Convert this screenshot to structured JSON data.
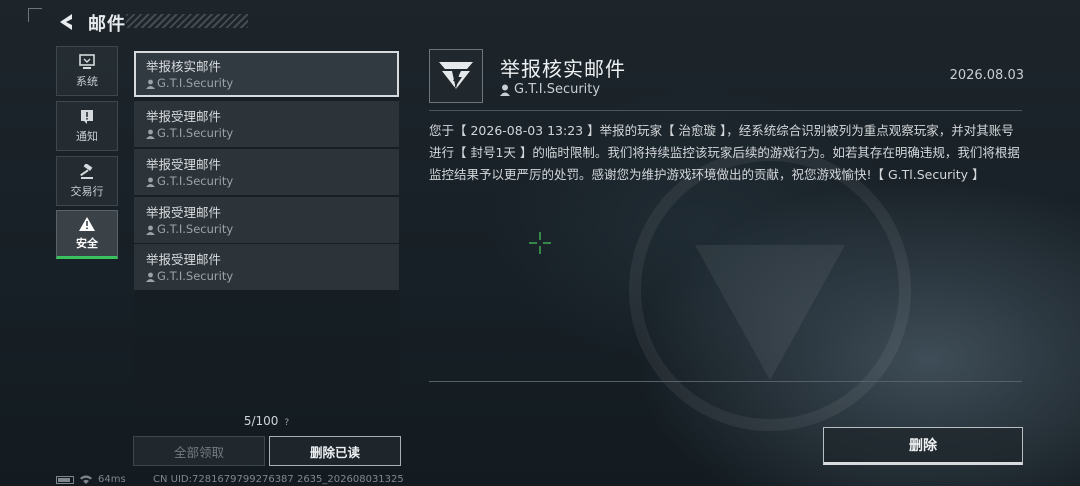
{
  "header": {
    "title": "邮件",
    "back_icon": "back-arrow-icon"
  },
  "categories": [
    {
      "label": "系统",
      "icon": "monitor-icon",
      "active": false
    },
    {
      "label": "通知",
      "icon": "alert-note-icon",
      "active": false
    },
    {
      "label": "交易行",
      "icon": "gavel-icon",
      "active": false
    },
    {
      "label": "安全",
      "icon": "warning-icon",
      "active": true
    }
  ],
  "mails": [
    {
      "subject": "举报核实邮件",
      "sender": "G.T.I.Security",
      "selected": true
    },
    {
      "subject": "举报受理邮件",
      "sender": "G.T.I.Security",
      "selected": false
    },
    {
      "subject": "举报受理邮件",
      "sender": "G.T.I.Security",
      "selected": false
    },
    {
      "subject": "举报受理邮件",
      "sender": "G.T.I.Security",
      "selected": false
    },
    {
      "subject": "举报受理邮件",
      "sender": "G.T.I.Security",
      "selected": false
    }
  ],
  "mail_count": "5/100",
  "help_mark": "?",
  "buttons": {
    "claim_all": "全部领取",
    "delete_read": "删除已读",
    "delete": "删除"
  },
  "detail": {
    "title": "举报核实邮件",
    "sender": "G.T.I.Security",
    "date": "2026.08.03",
    "body": "您于【 2026-08-03 13:23 】举报的玩家【 治愈璇 】，经系统综合识别被列为重点观察玩家，并对其账号进行【 封号1天 】的临时限制。我们将持续监控该玩家后续的游戏行为。如若其存在明确违规，我们将根据监控结果予以更严厉的处罚。感谢您为维护游戏环境做出的贡献，祝您游戏愉快!【 G.Tl.Security 】"
  },
  "status": {
    "ping": "64ms",
    "uid": "CN UID:7281679799276387 2635_202608031325"
  },
  "colors": {
    "accent_green": "#39c15d",
    "background": "#1a2228"
  }
}
